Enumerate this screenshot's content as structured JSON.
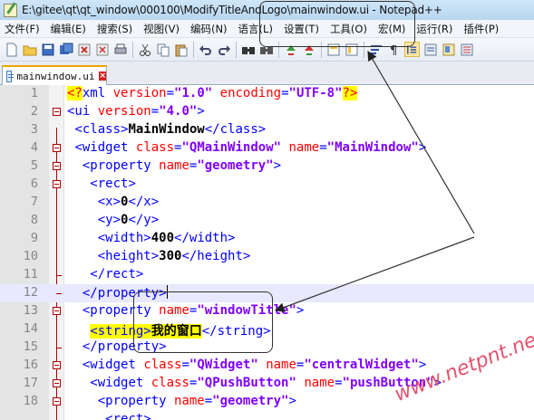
{
  "window": {
    "title": "E:\\gitee\\qt\\qt_window\\000100\\ModifyTitleAndLogo\\mainwindow.ui - Notepad++"
  },
  "menubar": {
    "items": [
      "文件(F)",
      "编辑(E)",
      "搜索(S)",
      "视图(V)",
      "编码(N)",
      "语言(L)",
      "设置(T)",
      "工具(O)",
      "宏(M)",
      "运行(R)",
      "插件(P)"
    ]
  },
  "toolbar": {
    "icons": [
      "new-file-icon",
      "open-file-icon",
      "save-icon",
      "save-all-icon",
      "close-icon",
      "close-all-icon",
      "print-icon",
      "cut-icon",
      "copy-icon",
      "paste-icon",
      "undo-icon",
      "redo-icon",
      "find-icon",
      "replace-icon",
      "zoom-in-icon",
      "zoom-out-icon",
      "sync-vertical-icon",
      "sync-horizontal-icon",
      "word-wrap-icon",
      "show-all-chars-icon",
      "indent-guide-icon",
      "udl-icon",
      "doc-map-icon",
      "function-list-icon"
    ]
  },
  "tabs": [
    {
      "label": "mainwindow.ui"
    }
  ],
  "editor": {
    "current_line": 12,
    "lines": [
      {
        "n": "1"
      },
      {
        "n": "2"
      },
      {
        "n": "3"
      },
      {
        "n": "4"
      },
      {
        "n": "5"
      },
      {
        "n": "6"
      },
      {
        "n": "7"
      },
      {
        "n": "8"
      },
      {
        "n": "9"
      },
      {
        "n": "10"
      },
      {
        "n": "11"
      },
      {
        "n": "12"
      },
      {
        "n": "13"
      },
      {
        "n": "14"
      },
      {
        "n": "15"
      },
      {
        "n": "16"
      },
      {
        "n": "17"
      },
      {
        "n": "18"
      }
    ],
    "code": {
      "l1": {
        "pi_open": "<?",
        "name": "xml",
        "a1": "version",
        "v1": "\"1.0\"",
        "a2": "encoding",
        "v2": "\"UTF-8\"",
        "pi_close": "?>"
      },
      "l2": {
        "open": "<ui",
        "a1": "version",
        "v1": "\"4.0\"",
        "close": ">"
      },
      "l3": {
        "open": "<class>",
        "text": "MainWindow",
        "close": "</class>"
      },
      "l4": {
        "open": "<widget",
        "a1": "class",
        "v1": "\"QMainWindow\"",
        "a2": "name",
        "v2": "\"MainWindow\"",
        "close": ">"
      },
      "l5": {
        "open": "<property",
        "a1": "name",
        "v1": "\"geometry\"",
        "close": ">"
      },
      "l6": {
        "open": "<rect>"
      },
      "l7": {
        "open": "<x>",
        "text": "0",
        "close": "</x>"
      },
      "l8": {
        "open": "<y>",
        "text": "0",
        "close": "</y>"
      },
      "l9": {
        "open": "<width>",
        "text": "400",
        "close": "</width>"
      },
      "l10": {
        "open": "<height>",
        "text": "300",
        "close": "</height>"
      },
      "l11": {
        "close": "</rect>"
      },
      "l12": {
        "close": "</property>"
      },
      "l13": {
        "open": "<property",
        "a1": "name",
        "v1": "\"windowTitle\"",
        "close": ">"
      },
      "l14": {
        "open": "<string>",
        "text": "我的窗口",
        "close": "</string>"
      },
      "l15": {
        "close": "</property>"
      },
      "l16": {
        "open": "<widget",
        "a1": "class",
        "v1": "\"QWidget\"",
        "a2": "name",
        "v2": "\"centralWidget\"",
        "close": ">"
      },
      "l17": {
        "open": "<widget",
        "a1": "class",
        "v1": "\"QPushButton\"",
        "a2": "name",
        "v2": "\"pushButton\"",
        "close": ">"
      },
      "l18": {
        "open": "<property",
        "a1": "name",
        "v1": "\"geometry\"",
        "close": ">"
      },
      "l19": {
        "open": "<rect>"
      }
    }
  },
  "watermark": "www.netpnt.net",
  "colors": {
    "tag": "#0000ff",
    "attribute": "#ff0000",
    "value": "#8000ff",
    "highlight": "#ffff00",
    "current_line": "#e8e8ff"
  }
}
